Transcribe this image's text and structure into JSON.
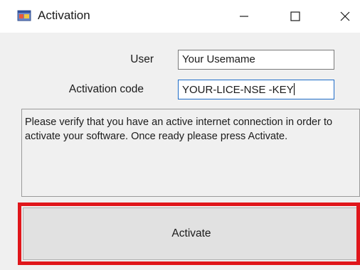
{
  "window": {
    "title": "Activation",
    "app_icon": "windows-app-icon",
    "controls": {
      "minimize_icon": "minimize-icon",
      "maximize_icon": "maximize-icon",
      "close_icon": "close-icon"
    }
  },
  "form": {
    "user_label": "User",
    "user_value": "Your Usemame",
    "activation_code_label": "Activation code",
    "activation_code_value": "YOUR-LICE-NSE -KEY"
  },
  "message": "Please verify that you have an active internet connection in order to activate your software. Once ready please press Activate.",
  "activate_button_label": "Activate",
  "colors": {
    "highlight": "#e0161b",
    "focus_border": "#1e6cc8",
    "background": "#f0f0f0"
  }
}
